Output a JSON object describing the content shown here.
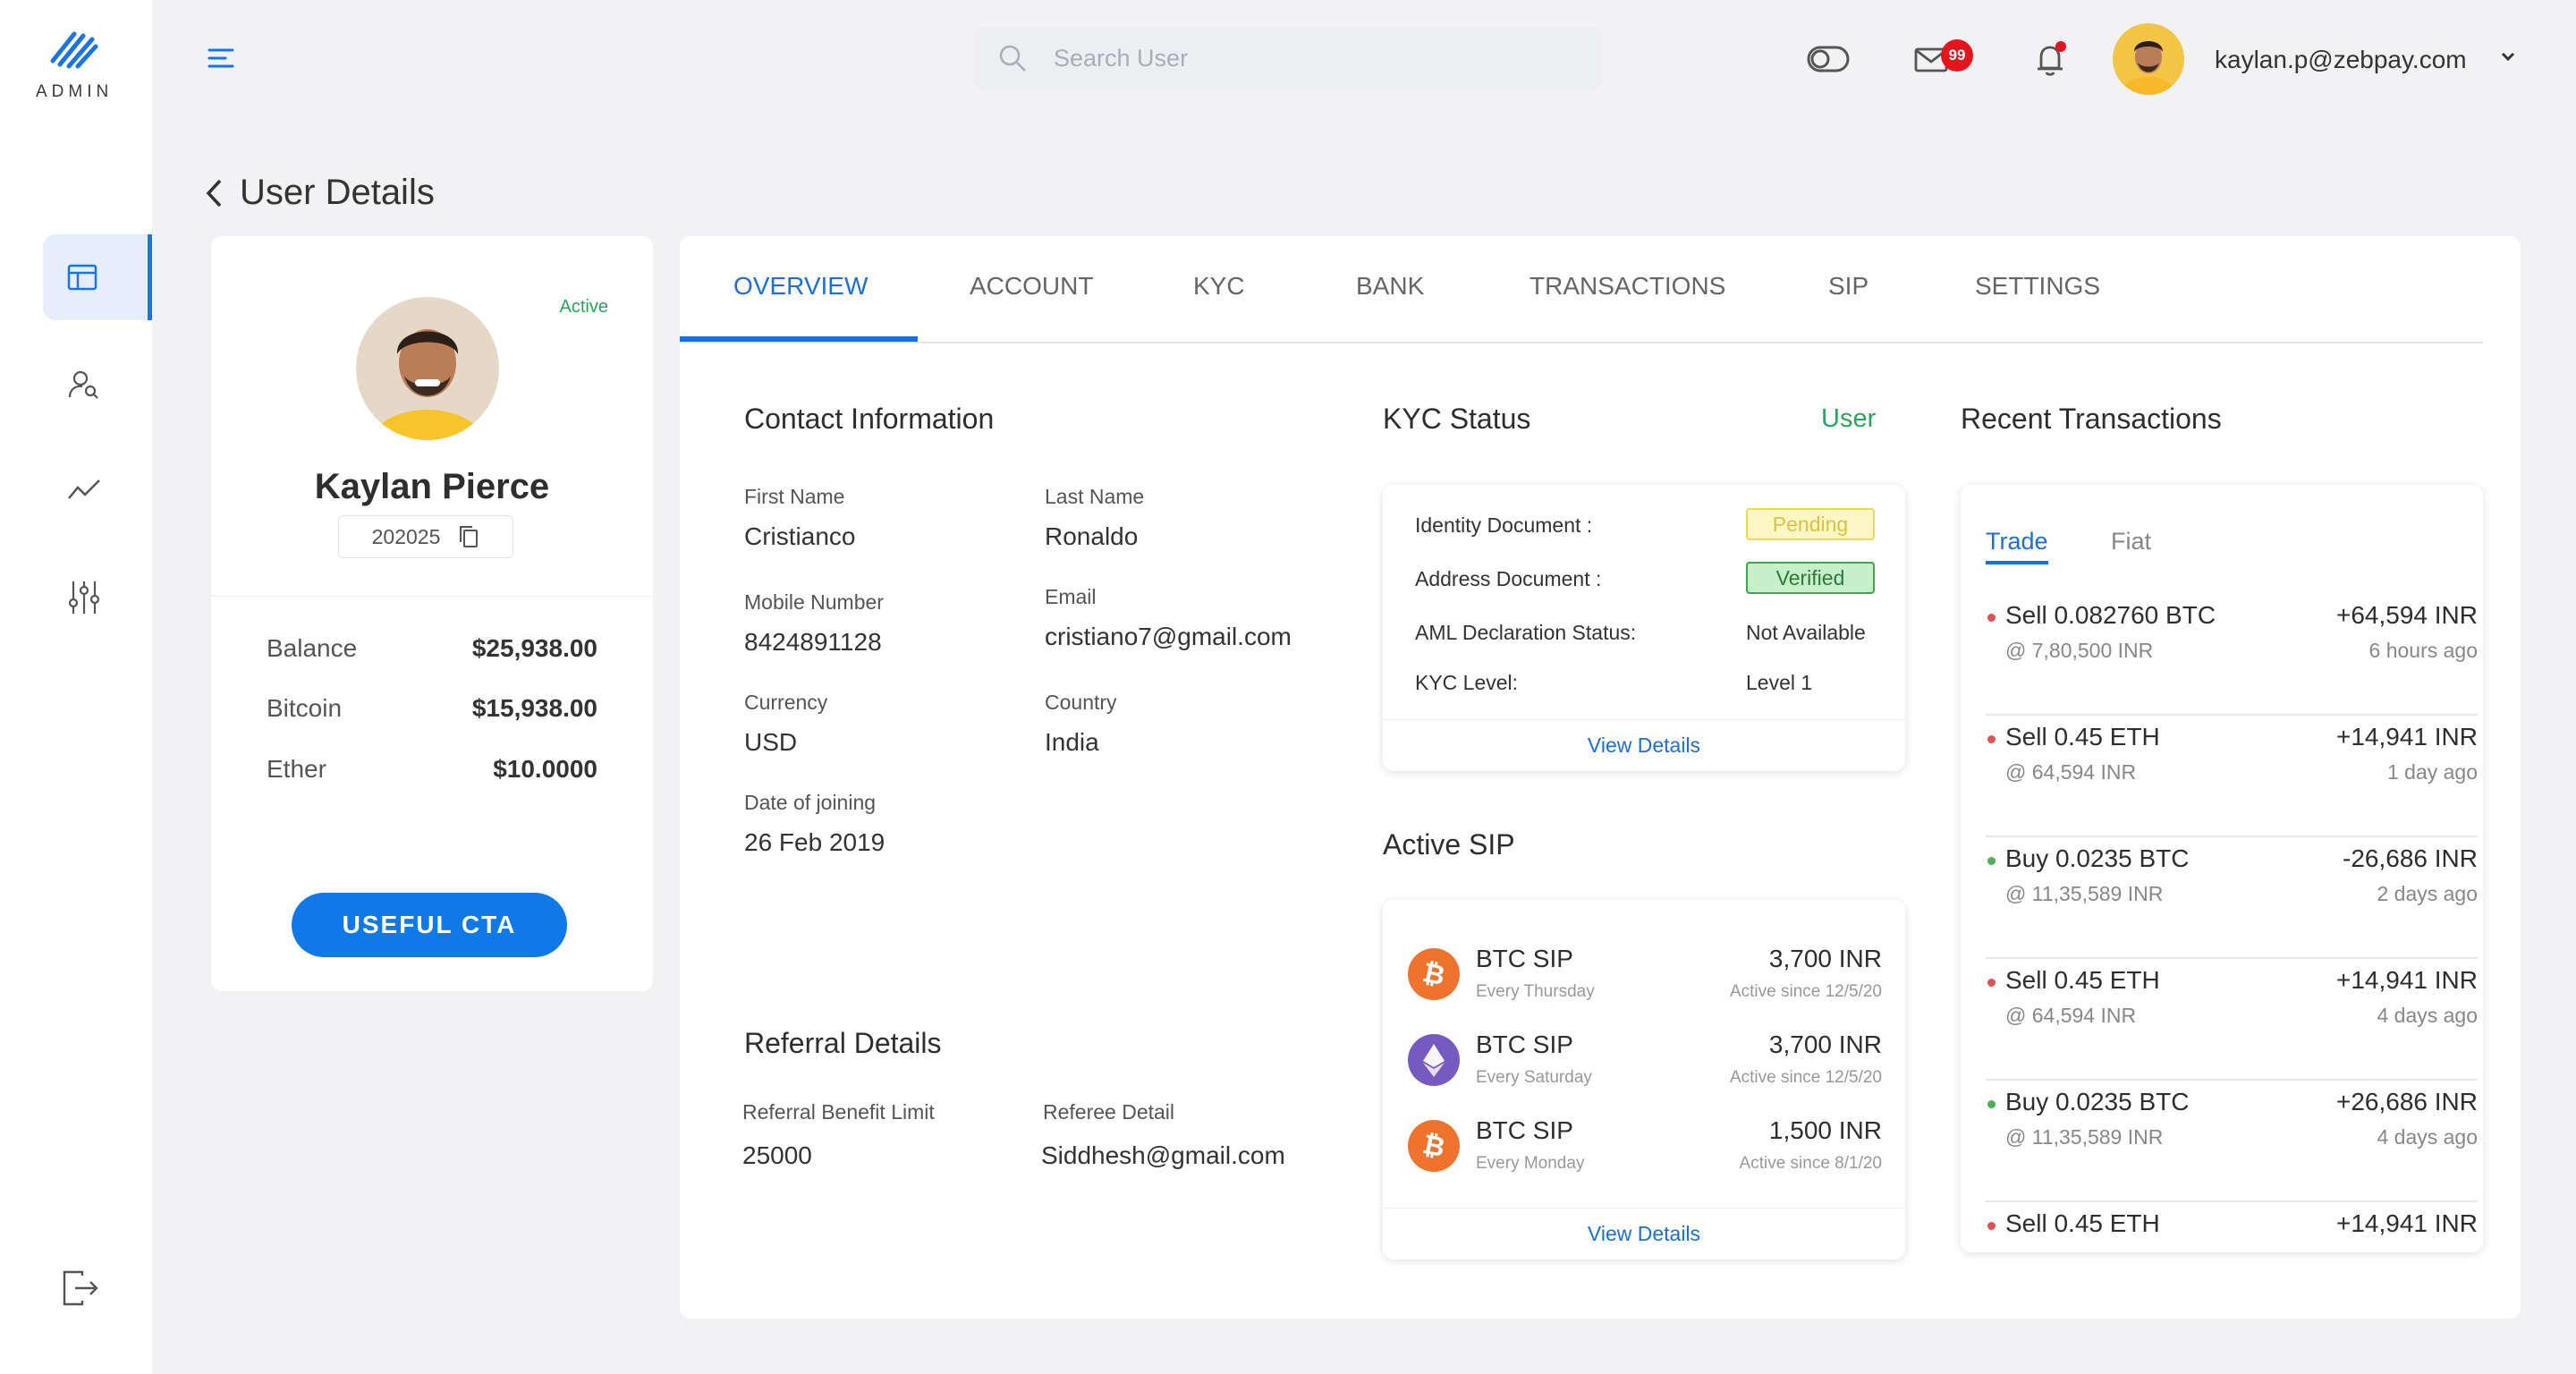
{
  "brand": {
    "name": "ADMIN",
    "accent": "#1a73e8"
  },
  "sidebar": {
    "items": [
      {
        "icon": "dashboard-icon",
        "active": true
      },
      {
        "icon": "user-search-icon",
        "active": false
      },
      {
        "icon": "chart-line-icon",
        "active": false
      },
      {
        "icon": "sliders-icon",
        "active": false
      }
    ],
    "logout_icon": "logout-icon"
  },
  "header": {
    "search_placeholder": "Search User",
    "mail_count": "99",
    "user_email": "kaylan.p@zebpay.com"
  },
  "page": {
    "title": "User Details"
  },
  "profile": {
    "status": "Active",
    "name": "Kaylan Pierce",
    "id": "202025",
    "balances": [
      {
        "label": "Balance",
        "value": "$25,938.00"
      },
      {
        "label": "Bitcoin",
        "value": "$15,938.00"
      },
      {
        "label": "Ether",
        "value": "$10.0000"
      }
    ],
    "cta": "USEFUL CTA"
  },
  "tabs": [
    "OVERVIEW",
    "ACCOUNT",
    "KYC",
    "BANK",
    "TRANSACTIONS",
    "SIP",
    "SETTINGS"
  ],
  "contact": {
    "title": "Contact Information",
    "first_name_label": "First Name",
    "first_name": "Cristianco",
    "last_name_label": "Last Name",
    "last_name": "Ronaldo",
    "mobile_label": "Mobile Number",
    "mobile": "8424891128",
    "email_label": "Email",
    "email": "cristiano7@gmail.com",
    "currency_label": "Currency",
    "currency": "USD",
    "country_label": "Country",
    "country": "India",
    "doj_label": "Date of joining",
    "doj": "26 Feb 2019"
  },
  "referral": {
    "title": "Referral Details",
    "limit_label": "Referral Benefit Limit",
    "limit": "25000",
    "referee_label": "Referee Detail",
    "referee": "Siddhesh@gmail.com"
  },
  "kyc": {
    "title": "KYC Status",
    "type": "User",
    "identity_label": "Identity Document :",
    "identity": "Pending",
    "address_label": "Address Document :",
    "address": "Verified",
    "aml_label": "AML Declaration Status:",
    "aml": "Not Available",
    "level_label": "KYC Level:",
    "level": "Level 1",
    "view_details": "View Details"
  },
  "sip": {
    "title": "Active SIP",
    "items": [
      {
        "coin": "btc",
        "name": "BTC SIP",
        "freq": "Every Thursday",
        "amount": "3,700 INR",
        "since": "Active since 12/5/20"
      },
      {
        "coin": "eth",
        "name": "BTC SIP",
        "freq": "Every Saturday",
        "amount": "3,700 INR",
        "since": "Active since 12/5/20"
      },
      {
        "coin": "btc",
        "name": "BTC SIP",
        "freq": "Every Monday",
        "amount": "1,500 INR",
        "since": "Active since 8/1/20"
      }
    ],
    "view_details": "View Details"
  },
  "transactions": {
    "title": "Recent Transactions",
    "tab_trade": "Trade",
    "tab_fiat": "Fiat",
    "items": [
      {
        "side": "sell",
        "title": "Sell 0.082760 BTC",
        "rate": "@ 7,80,500 INR",
        "amount": "+64,594 INR",
        "time": "6 hours ago"
      },
      {
        "side": "sell",
        "title": "Sell 0.45 ETH",
        "rate": "@ 64,594 INR",
        "amount": "+14,941 INR",
        "time": "1 day ago"
      },
      {
        "side": "buy",
        "title": "Buy 0.0235 BTC",
        "rate": "@ 11,35,589 INR",
        "amount": "-26,686 INR",
        "time": "2 days ago"
      },
      {
        "side": "sell",
        "title": "Sell 0.45 ETH",
        "rate": "@ 64,594 INR",
        "amount": "+14,941 INR",
        "time": "4 days ago"
      },
      {
        "side": "buy",
        "title": "Buy 0.0235 BTC",
        "rate": "@ 11,35,589 INR",
        "amount": "+26,686 INR",
        "time": "4 days ago"
      },
      {
        "side": "sell",
        "title": "Sell 0.45 ETH",
        "rate": "",
        "amount": "+14,941 INR",
        "time": ""
      }
    ],
    "colors": {
      "sell": "#e05252",
      "buy": "#4caf50"
    }
  }
}
